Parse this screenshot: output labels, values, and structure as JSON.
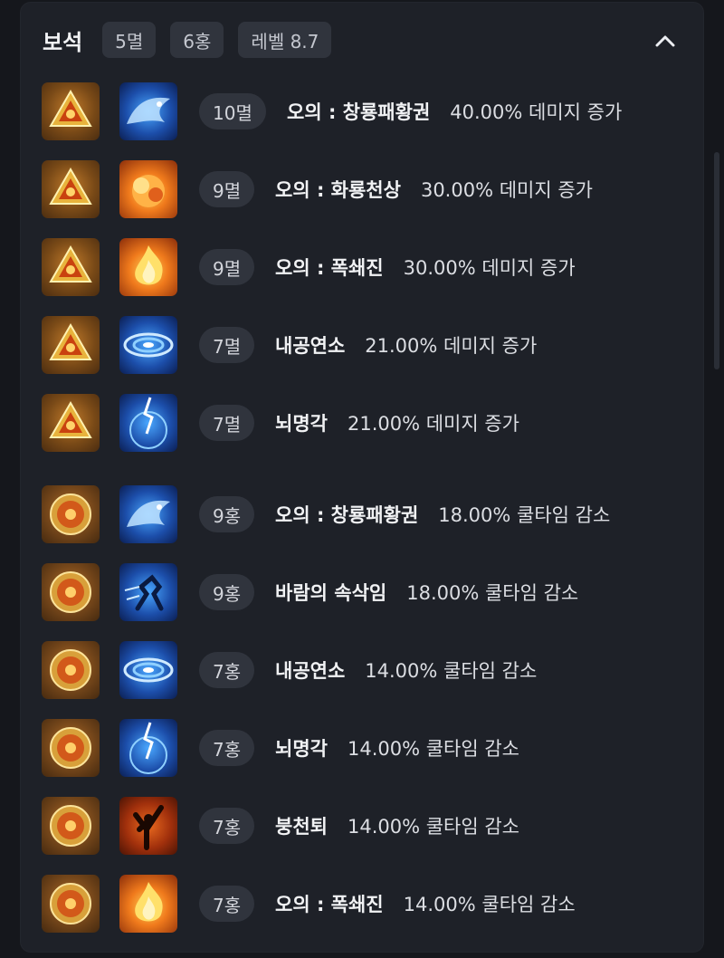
{
  "header": {
    "title": "보석",
    "badges": [
      "5멸",
      "6홍",
      "레벨 8.7"
    ],
    "collapse_icon": "chevron-up-icon"
  },
  "rows": [
    {
      "gem_type": "멸",
      "skill_icon": "dragon-blue",
      "level": "10멸",
      "skill": "오의 : 창룡패황권",
      "effect": "40.00% 데미지 증가"
    },
    {
      "gem_type": "멸",
      "skill_icon": "explosion-fire",
      "level": "9멸",
      "skill": "오의 : 화룡천상",
      "effect": "30.00% 데미지 증가"
    },
    {
      "gem_type": "멸",
      "skill_icon": "flame-burst",
      "level": "9멸",
      "skill": "오의 : 폭쇄진",
      "effect": "30.00% 데미지 증가"
    },
    {
      "gem_type": "멸",
      "skill_icon": "vortex-blue",
      "level": "7멸",
      "skill": "내공연소",
      "effect": "21.00% 데미지 증가"
    },
    {
      "gem_type": "멸",
      "skill_icon": "lightning-blue",
      "level": "7멸",
      "skill": "뇌명각",
      "effect": "21.00% 데미지 증가"
    },
    {
      "gem_type": "홍",
      "skill_icon": "dragon-blue",
      "level": "9홍",
      "skill": "오의 : 창룡패황권",
      "effect": "18.00% 쿨타임 감소"
    },
    {
      "gem_type": "홍",
      "skill_icon": "dash-blue",
      "level": "9홍",
      "skill": "바람의 속삭임",
      "effect": "18.00% 쿨타임 감소"
    },
    {
      "gem_type": "홍",
      "skill_icon": "vortex-blue",
      "level": "7홍",
      "skill": "내공연소",
      "effect": "14.00% 쿨타임 감소"
    },
    {
      "gem_type": "홍",
      "skill_icon": "lightning-blue",
      "level": "7홍",
      "skill": "뇌명각",
      "effect": "14.00% 쿨타임 감소"
    },
    {
      "gem_type": "홍",
      "skill_icon": "kick-fire",
      "level": "7홍",
      "skill": "붕천퇴",
      "effect": "14.00% 쿨타임 감소"
    },
    {
      "gem_type": "홍",
      "skill_icon": "flame-burst",
      "level": "7홍",
      "skill": "오의 : 폭쇄진",
      "effect": "14.00% 쿨타임 감소"
    }
  ]
}
